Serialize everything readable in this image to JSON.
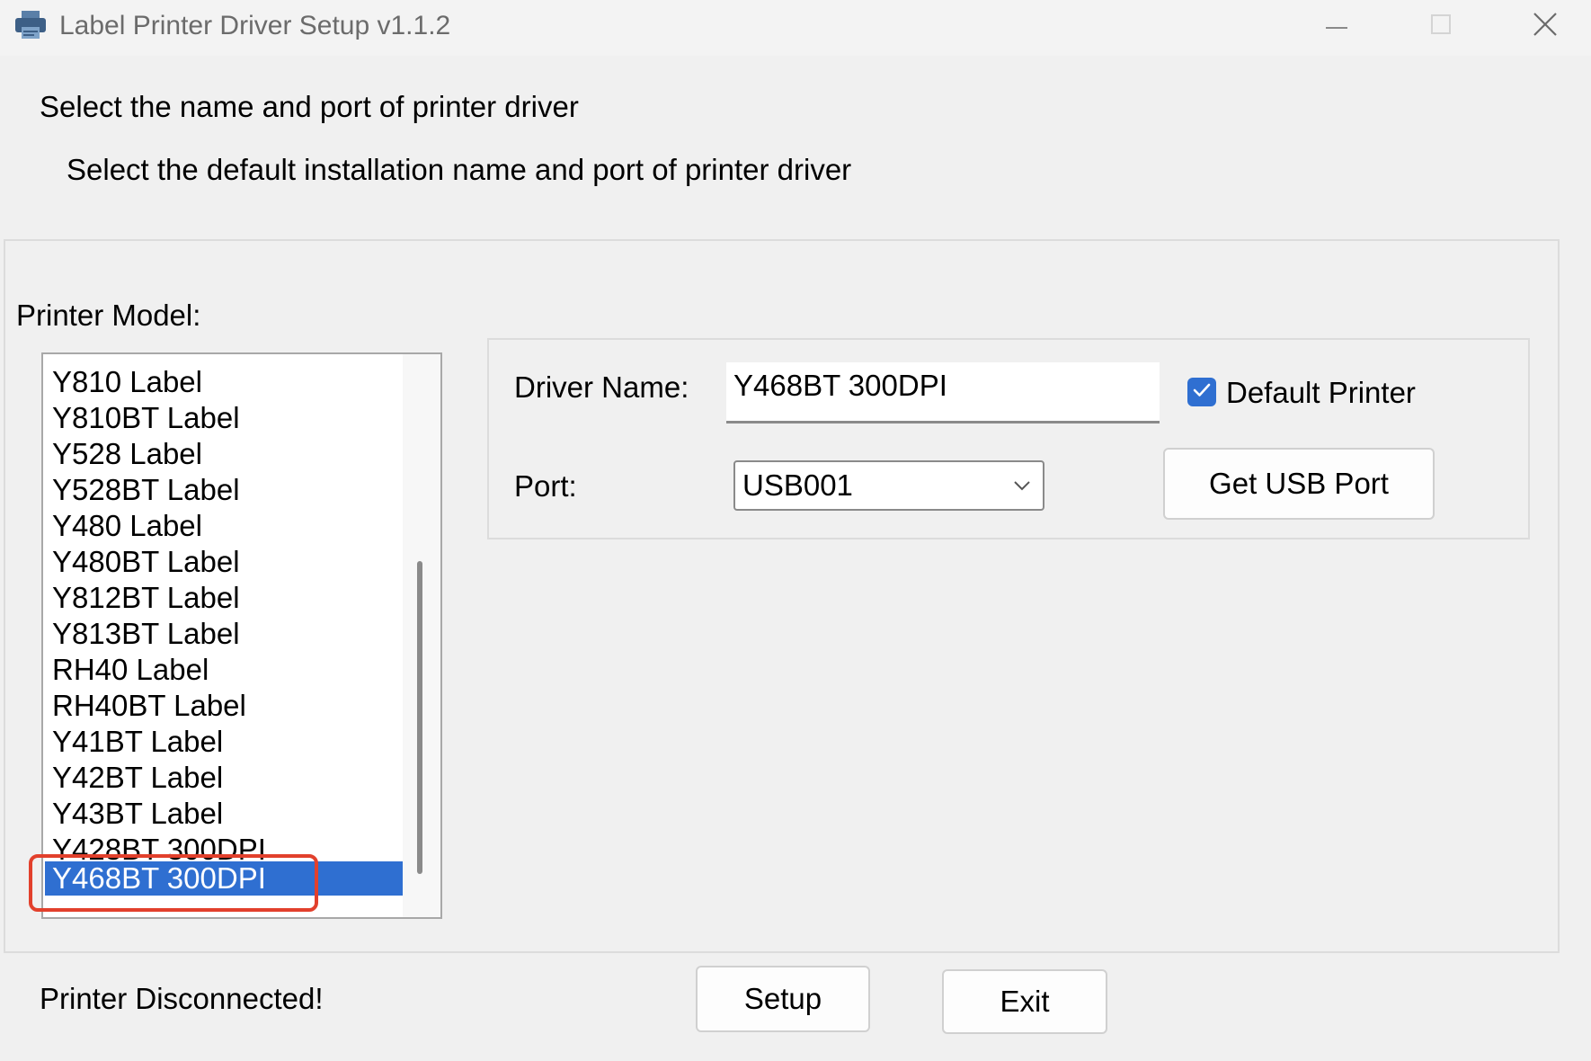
{
  "window": {
    "title": "Label Printer Driver Setup v1.1.2"
  },
  "header": {
    "heading": "Select the name and port of printer driver",
    "subheading": "Select the default installation name and port of printer driver"
  },
  "printer_model": {
    "label": "Printer Model:",
    "items": [
      "Y810 Label",
      "Y810BT Label",
      "Y528 Label",
      "Y528BT Label",
      "Y480 Label",
      "Y480BT Label",
      "Y812BT Label",
      "Y813BT Label",
      "RH40 Label",
      "RH40BT Label",
      "Y41BT Label",
      "Y42BT Label",
      "Y43BT Label",
      "Y428BT 300DPI",
      "Y468BT 300DPI"
    ],
    "selected": "Y468BT 300DPI"
  },
  "driver": {
    "name_label": "Driver Name:",
    "name_value": "Y468BT 300DPI",
    "default_printer_label": "Default Printer",
    "default_printer_checked": true
  },
  "port": {
    "label": "Port:",
    "value": "USB001",
    "get_usb_button": "Get USB Port"
  },
  "footer": {
    "status": "Printer Disconnected!",
    "setup_button": "Setup",
    "exit_button": "Exit"
  },
  "colors": {
    "selection": "#2f6fd1",
    "highlight_annotation": "#e2402c",
    "checkbox": "#2f6fd1"
  },
  "icons": {
    "app": "printer-icon",
    "minimize": "minimize-icon",
    "maximize": "maximize-icon",
    "close": "close-icon",
    "dropdown": "chevron-down-icon",
    "check": "checkmark-icon"
  }
}
